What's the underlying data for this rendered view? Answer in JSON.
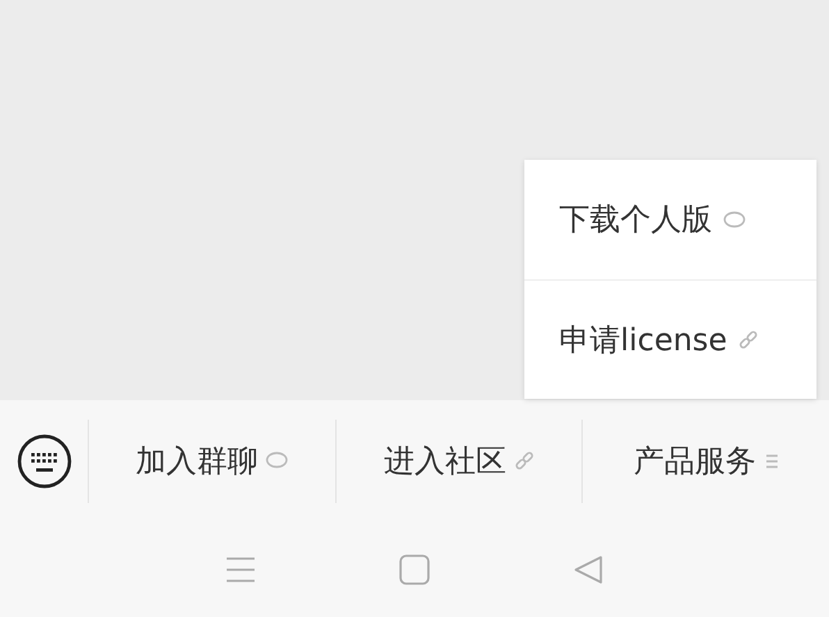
{
  "popup_menu": {
    "items": [
      {
        "label": "下载个人版",
        "kind": "chat"
      },
      {
        "label": "申请license",
        "kind": "link"
      }
    ]
  },
  "menu_bar": {
    "items": [
      {
        "label": "加入群聊",
        "kind": "chat"
      },
      {
        "label": "进入社区",
        "kind": "link"
      },
      {
        "label": "产品服务",
        "kind": "list"
      }
    ]
  }
}
